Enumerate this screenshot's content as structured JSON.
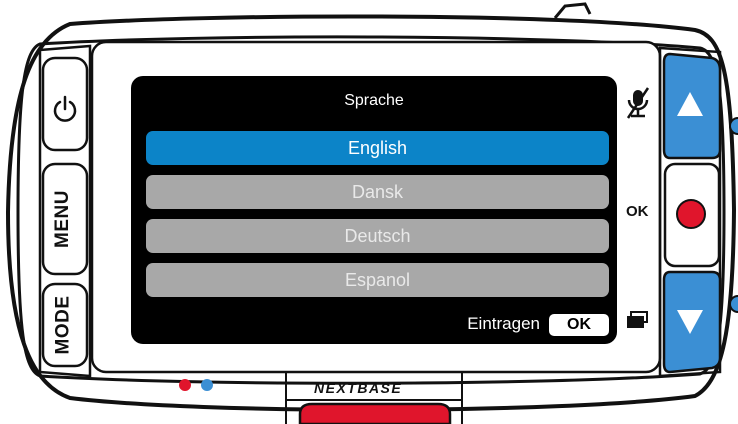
{
  "device": {
    "brand": "NEXTBASE",
    "colors": {
      "accent_blue": "#3b8fd4",
      "record_red": "#e0152c",
      "selection_blue": "#0c84c8",
      "item_gray": "#a8a8a8"
    }
  },
  "left_buttons": {
    "power": {
      "icon": "power-icon"
    },
    "menu_label": "MENU",
    "mode_label": "MODE"
  },
  "right_side": {
    "mic_icon": "microphone-muted-icon",
    "ok_label": "OK",
    "screen_switch_icon": "overlapping-windows-icon",
    "up_icon": "triangle-up-icon",
    "down_icon": "triangle-down-icon",
    "record_icon": "record-dot-icon"
  },
  "screen": {
    "title": "Sprache",
    "languages": [
      {
        "label": "English",
        "selected": true
      },
      {
        "label": "Dansk",
        "selected": false
      },
      {
        "label": "Deutsch",
        "selected": false
      },
      {
        "label": "Espanol",
        "selected": false
      }
    ],
    "confirm_label": "Eintragen",
    "confirm_button": "OK"
  }
}
